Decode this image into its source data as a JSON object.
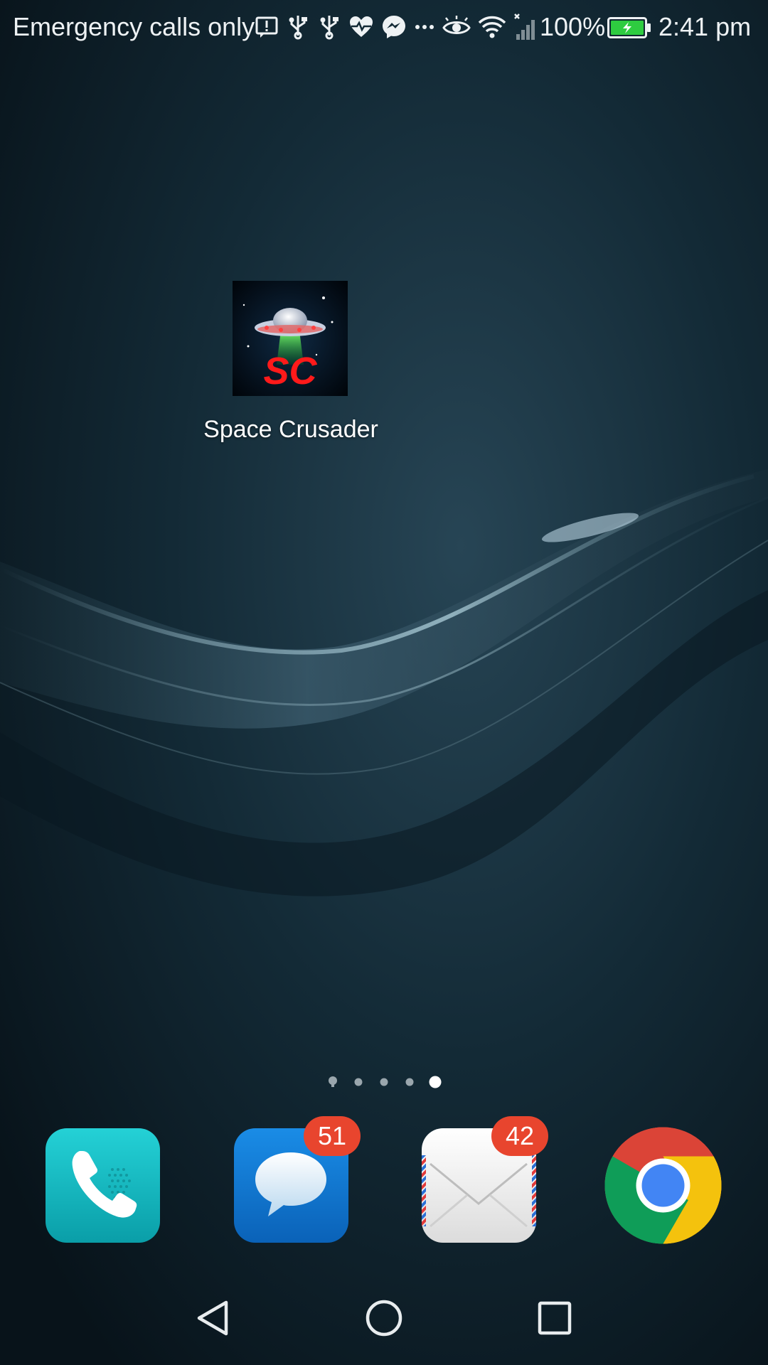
{
  "status_bar": {
    "carrier_text": "Emergency calls only",
    "battery_percent": "100%",
    "time": "2:41 pm",
    "icons": [
      "alert-icon",
      "usb-icon",
      "usb-icon",
      "health-icon",
      "messenger-icon",
      "more-icon",
      "eye-icon",
      "wifi-icon",
      "signal-icon"
    ],
    "battery_color": "#2ecc40"
  },
  "home": {
    "app": {
      "label": "Space Crusader",
      "icon_text": "SC",
      "icon_text_color": "#ff1a1a"
    },
    "page_count": 5,
    "active_page": 5
  },
  "dock": {
    "apps": [
      {
        "name": "Phone",
        "icon": "phone-icon",
        "badge": ""
      },
      {
        "name": "Messages",
        "icon": "messages-icon",
        "badge": "51"
      },
      {
        "name": "Email",
        "icon": "email-icon",
        "badge": "42"
      },
      {
        "name": "Chrome",
        "icon": "chrome-icon",
        "badge": ""
      }
    ]
  },
  "navigation": {
    "buttons": [
      "back-icon",
      "home-icon",
      "recents-icon"
    ]
  }
}
